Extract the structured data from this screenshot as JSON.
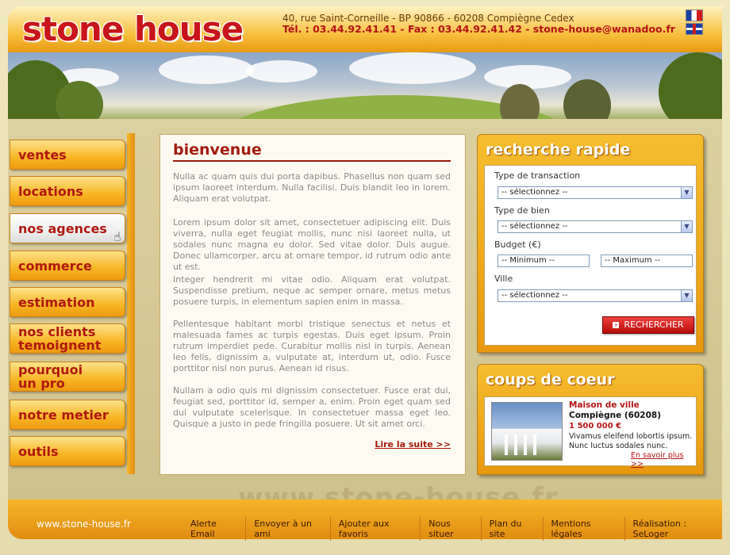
{
  "brand": {
    "logo": "stone house"
  },
  "header": {
    "address": "40, rue Saint-Corneille - BP 90866 - 60208 Compiègne Cedex",
    "contact": "Tél. : 03.44.92.41.41 - Fax : 03.44.92.41.42 - stone-house@wanadoo.fr",
    "flags": [
      "fr-flag-icon",
      "uk-flag-icon"
    ]
  },
  "nav": {
    "items": [
      {
        "label": "ventes"
      },
      {
        "label": "locations"
      },
      {
        "label": "nos agences"
      },
      {
        "label": "commerce"
      },
      {
        "label": "estimation"
      },
      {
        "label": "nos clients temoignent"
      },
      {
        "label": "pourquoi un pro"
      },
      {
        "label": "notre metier"
      },
      {
        "label": "outils"
      }
    ],
    "active": "nos agences"
  },
  "main": {
    "title": "bienvenue",
    "paragraphs": [
      "Nulla ac quam quis dui porta dapibus. Phasellus non quam sed ipsum laoreet interdum. Nulla facilisi. Duis blandit leo in lorem. Aliquam erat volutpat.",
      "Lorem ipsum dolor sit amet, consectetuer adipiscing elit. Duis viverra, nulla eget feugiat mollis, nunc nisi laoreet nulla, ut sodales nunc magna eu dolor. Sed vitae dolor. Duis augue. Donec ullamcorper, arcu at ornare tempor, id rutrum odio ante ut est.",
      "Integer hendrerit mi vitae odio. Aliquam erat volutpat. Suspendisse pretium, neque ac semper ornare, metus metus posuere turpis, in elementum sapien enim in massa.",
      "Pellentesque habitant morbi tristique senectus et netus et malesuada fames ac turpis egestas. Duis eget ipsum. Proin rutrum imperdiet pede. Curabitur mollis nisl in turpis. Aenean leo felis, dignissim a, vulputate at, interdum ut, odio. Fusce porttitor nisl non purus. Aenean id risus.",
      "Nullam a odio quis mi dignissim consectetuer. Fusce erat dui, feugiat sed, porttitor id, semper a, enim. Proin eget quam sed dui vulputate scelerisque. In consectetuer massa eget leo. Quisque a justo in pede fringilla posuere. Ut sit amet orci."
    ],
    "more_link": "Lire la suite >>"
  },
  "search": {
    "title": "recherche rapide",
    "transaction_label": "Type de transaction",
    "transaction_value": "-- sélectionnez --",
    "bien_label": "Type de bien",
    "bien_value": "-- sélectionnez --",
    "budget_label": "Budget (€)",
    "min_value": "-- Minimum --",
    "max_value": "-- Maximum --",
    "ville_label": "Ville",
    "ville_value": "-- sélectionnez --",
    "button_label": "RECHERCHER"
  },
  "coeur": {
    "title": "coups de coeur",
    "type": "Maison de ville",
    "city": "Compiègne (60208)",
    "price": "1 500 000 €",
    "desc": "Vivamus eleifend lobortis ipsum. Nunc luctus sodales nunc.",
    "link": "En savoir plus >>"
  },
  "watermark": "www.stone-house.fr",
  "footer": {
    "site": "www.stone-house.fr",
    "links": [
      "Alerte Email",
      "Envoyer à un ami",
      "Ajouter aux favoris",
      "Nous situer",
      "Plan du site",
      "Mentions légales",
      "Réalisation : SeLoger"
    ]
  },
  "colors": {
    "accent": "#f7b523",
    "brand_red": "#c8141b"
  }
}
